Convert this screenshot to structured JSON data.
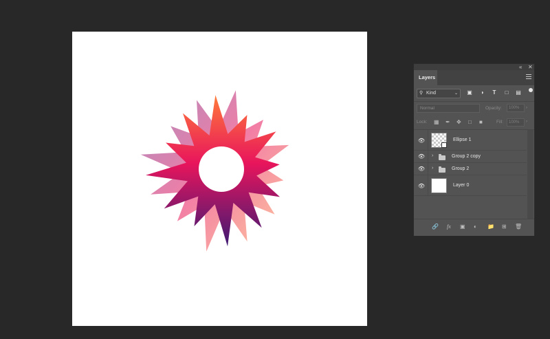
{
  "panel": {
    "collapse_glyph": "«",
    "close_glyph": "✕",
    "tab_title": "Layers",
    "menu_icon": "panel-menu-icon"
  },
  "filter": {
    "kind_label": "Kind",
    "icons": [
      "pixel-filter-icon",
      "adjustment-filter-icon",
      "type-filter-icon",
      "shape-filter-icon",
      "smart-object-filter-icon"
    ],
    "type_glyph": "T"
  },
  "blend": {
    "mode": "Normal",
    "opacity_label": "Opacity:",
    "opacity_value": "100%",
    "lock_label": "Lock:",
    "fill_label": "Fill:",
    "fill_value": "100%"
  },
  "layers": [
    {
      "name": "Ellipse 1",
      "visible": true,
      "kind": "shape",
      "selected": false
    },
    {
      "name": "Group 2 copy",
      "visible": true,
      "kind": "group"
    },
    {
      "name": "Group 2",
      "visible": true,
      "kind": "group"
    },
    {
      "name": "Layer 0",
      "visible": true,
      "kind": "pixel"
    }
  ],
  "footer": {
    "fx_label": "fx",
    "icons": [
      "link-layers-icon",
      "layer-style-icon",
      "add-mask-icon",
      "adjustment-layer-icon",
      "new-group-icon",
      "new-layer-icon",
      "delete-layer-icon"
    ]
  },
  "colors": {
    "workspace": "#282828",
    "panel": "#535353",
    "canvas": "#ffffff",
    "starburst_pink": "#e8155c",
    "starburst_orange": "#ff8a3d",
    "starburst_purple": "#4b1a6e"
  }
}
